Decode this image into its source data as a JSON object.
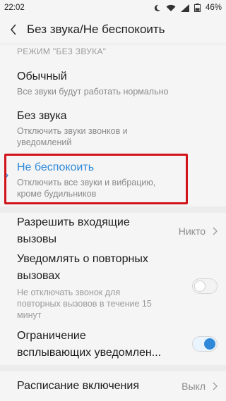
{
  "status_bar": {
    "time": "22:02",
    "battery": "46%",
    "icons": [
      "moon-icon",
      "wifi-icon",
      "signal-icon",
      "battery-icon"
    ]
  },
  "header": {
    "title": "Без звука/Не беспокоить"
  },
  "section": {
    "title": "РЕЖИМ \"БЕЗ ЗВУКА\""
  },
  "modes": [
    {
      "title": "Обычный",
      "subtitle": "Все звуки будут работать нормально"
    },
    {
      "title": "Без звука",
      "subtitle_line1": "Отключить звуки звонков и",
      "subtitle_line2": "уведомлений"
    },
    {
      "title": "Не беспокоить",
      "subtitle_line1": "Отключить все звуки и вибрацию,",
      "subtitle_line2": "кроме будильников",
      "selected": true
    }
  ],
  "settings": {
    "allow_incoming": {
      "title_line1": "Разрешить входящие",
      "title_line2": "вызовы",
      "value": "Никто"
    },
    "repeat_calls": {
      "title_line1": "Уведомлять о повторных",
      "title_line2": "вызовах",
      "subtitle_line1": "Не отключать звонок для",
      "subtitle_line2": "повторных вызовов в течение 15",
      "subtitle_line3": "минут",
      "enabled": false
    },
    "popup_limit": {
      "title_line1": "Ограничение",
      "title_line2": "всплывающих уведомлен...",
      "enabled": true
    },
    "schedule": {
      "title": "Расписание включения",
      "value": "Выкл"
    }
  },
  "colors": {
    "accent": "#2f89d8",
    "highlight_border": "#d0141a"
  }
}
